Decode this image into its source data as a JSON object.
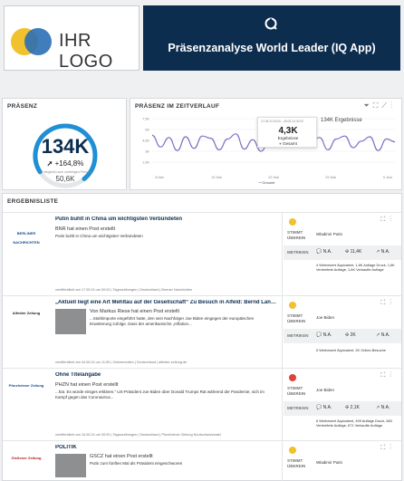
{
  "header": {
    "logo_text": "IHR LOGO",
    "title": "Präsenzanalyse World Leader (IQ App)",
    "brand_colors": {
      "dark": "#0d2d4f",
      "yellow": "#f2c12e",
      "blue": "#2a6fb5"
    }
  },
  "presence": {
    "title": "PRÄSENZ",
    "value": "134K",
    "change": "+164,8%",
    "compare_label": "Im Vergleich zum vorherigen Periode",
    "previous": "50,6K",
    "gauge_fraction": 0.73
  },
  "timeline": {
    "title": "PRÄSENZ IM ZEITVERLAUF",
    "toolbar_icons": [
      "filter-icon",
      "expand-icon",
      "chart-icon",
      "more-icon"
    ],
    "tooltip": {
      "range": "27.05.24 00:00 - 28.05.24 00:00",
      "value": "4,3K",
      "label": "Ergebnisse",
      "series": "Gesamt"
    },
    "tooltip_badge": "134K Ergebnisse",
    "legend": "Gesamt",
    "chart_data": {
      "type": "line",
      "x_ticks": [
        "8 Mai",
        "15 Mai",
        "22 Mai",
        "29 Mai",
        "5 Juni"
      ],
      "y_ticks": [
        "1,5K",
        "3K",
        "4,5K",
        "6K",
        "7,5K"
      ],
      "ylim": [
        0,
        8000
      ],
      "series": [
        {
          "name": "Gesamt",
          "values": [
            5200,
            3600,
            4900,
            3100,
            5000,
            3400,
            5100,
            4800,
            3200,
            4700,
            5400,
            3300,
            4600,
            3000,
            4500,
            4300,
            3900,
            4700,
            4500,
            4300,
            4900,
            3200,
            4700,
            5100,
            3500,
            4400,
            5000,
            3100,
            4700,
            4300
          ]
        }
      ]
    }
  },
  "results": {
    "title": "ERGEBNISLISTE",
    "labels": {
      "stimmt": "STIMMT ÜBEREIN",
      "metriken": "METRIKEN"
    },
    "items": [
      {
        "source_logo": "BERLINER NACHRICHTEN",
        "title": "Putin buhlt in China um wichtigsten Verbündeten",
        "author": "BNR   hat einen Post erstellt",
        "text": "Putin buhlt in China um wichtigsten Verbündeten",
        "footer": "veröffentlicht am 17.05.24 um 00:00 | Tageszeitungen | Deutschland | Bremer Nachrichten",
        "sentiment_color": "#f2c12e",
        "match": "Wladimir Putin",
        "metrics": [
          "N.A.",
          "11,4K",
          "N.A."
        ],
        "notes": "4 Werbewert Äquivalent, 1,8K Auflage Druck, 1,6K Verbreitete Auflage, 1,6K Verkaufte Auflage"
      },
      {
        "source_logo": "Alfelder Zeitung",
        "title": "„Aktuell liegt eine Art Mehltau auf der Gesellschaft“ Zu Besuch in Alfeld: Bernd Lange...",
        "author": "Von Markus Riese   hat einen Post erstellt",
        "text": "...Stahlimporte eingeführt hatte, den sein Nachfolger Joe Biden eingegen der europäischen Erweiterung zufolge. Dass der amerikanische „Inflation...",
        "footer": "veröffentlicht am 04.06.24 um 11:59 | Onlinemedien | Deutschland | alfelder-zeitung.de",
        "sentiment_color": "#f2c12e",
        "match": "Joe Biden",
        "metrics": [
          "N.A.",
          "2K",
          "N.A."
        ],
        "notes": "5 Werbewert Äquivalent, 2K Online-Besuche"
      },
      {
        "source_logo": "Pforzheimer Zeitung",
        "title": "Ohne Titelangabe",
        "author": "PHZN   hat einen Post erstellt",
        "text": "...hat. Es würde einiges erklären.“ US-Präsident Joe Biden über Donald Trumps Rat während der Pandemie, sich im Kampf gegen das Coronavirus...",
        "footer": "veröffentlicht am 16.05.24 um 00:00 | Tageszeitungen | Deutschland | Pforzheimer Zeitung Nordschwarzwald",
        "sentiment_color": "#e0413c",
        "match": "Joe Biden",
        "metrics": [
          "N.A.",
          "2,1K",
          "N.A."
        ],
        "notes": "6 Werbewert Äquivalent, 499 Auflage Druck, 683 Verbreitete Auflage, 671 Verkaufte Auflage"
      },
      {
        "source_logo": "Gießener Zeitung",
        "title": "POLITIK",
        "author": "GSCZ   hat einen Post erstellt",
        "text": "Putin zum fünften Mal als Präsident eingeschworen",
        "footer": "",
        "sentiment_color": "#f2c12e",
        "match": "Wladimir Putin",
        "metrics": [
          "",
          "",
          ""
        ],
        "notes": ""
      }
    ]
  }
}
